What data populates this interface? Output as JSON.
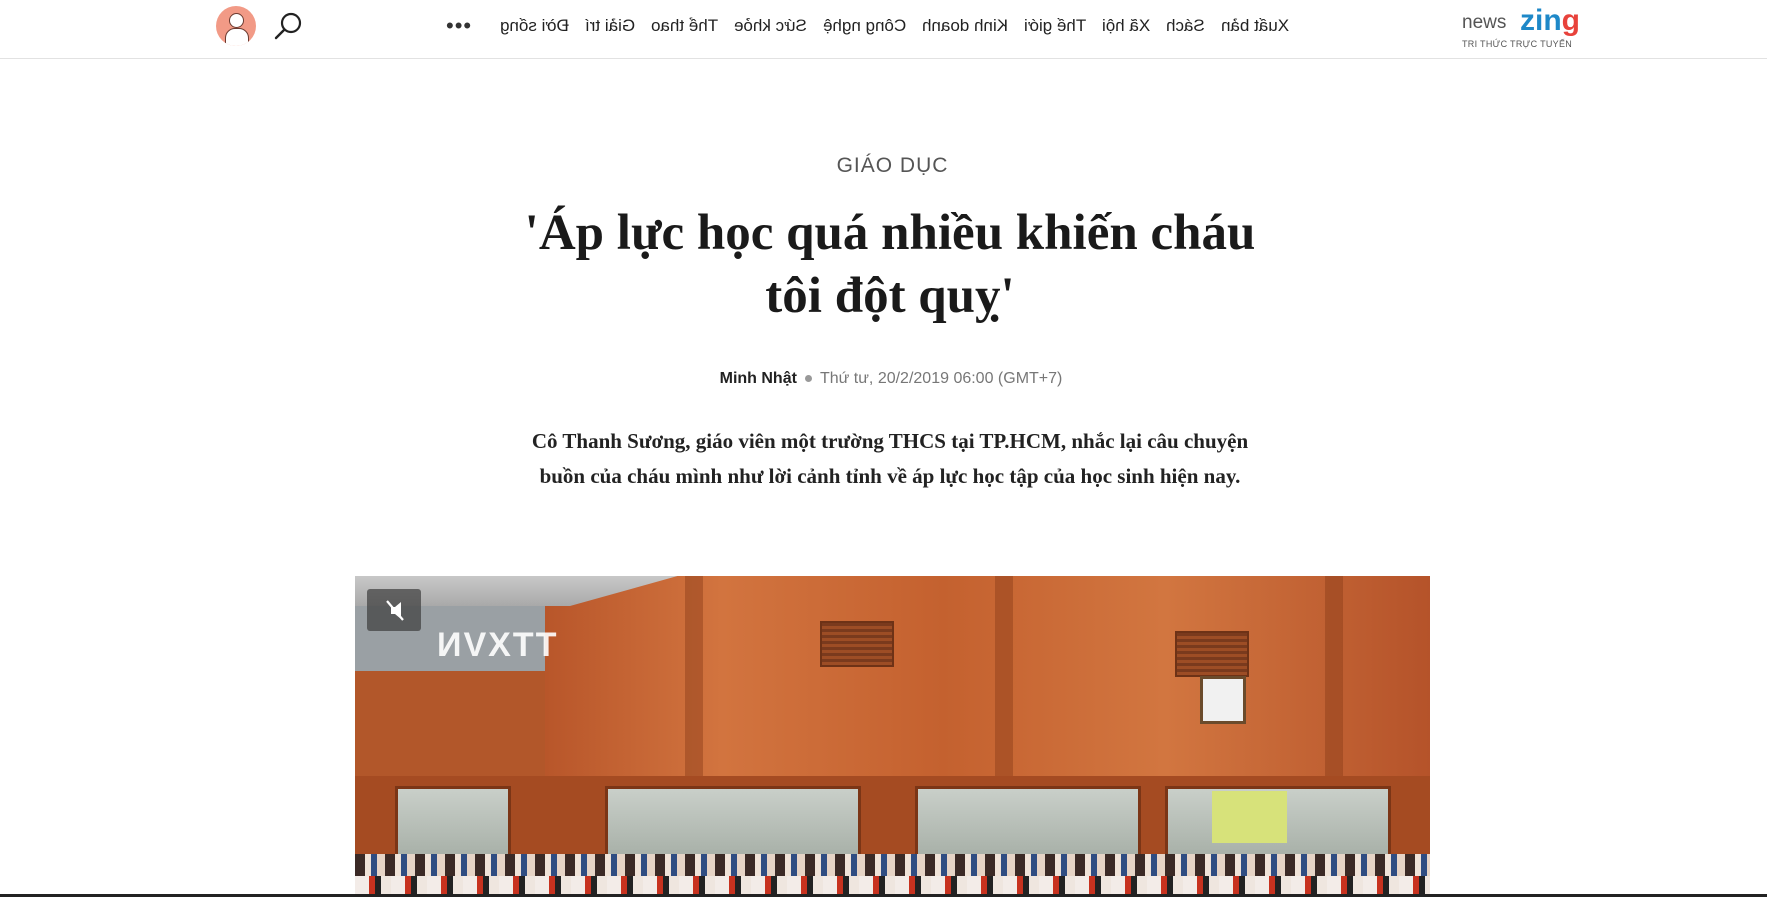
{
  "header": {
    "logo": {
      "brand": "zing",
      "suffix": "news",
      "tagline": "TRI THỨC TRỰC TUYẾN"
    },
    "nav_items": [
      "Xuất bản",
      "Sách",
      "Xã hội",
      "Thế giới",
      "Kinh doanh",
      "Công nghệ",
      "Sức khỏe",
      "Thể thao",
      "Giải trí",
      "Đời sống"
    ],
    "more_label": "•••",
    "icons": {
      "search": "search-icon",
      "avatar": "user-avatar-icon"
    }
  },
  "article": {
    "category": "GIÁO DỤC",
    "title": "'Áp lực học quá nhiều khiến cháu tôi đột quỵ'",
    "author": "Minh Nhật",
    "published": "Thứ tư, 20/2/2019 06:00 (GMT+7)",
    "sapo": "Cô Thanh Sương, giáo viên một trường THCS tại TP.HCM, nhắc lại câu chuyện buồn của cháu mình như lời cảnh tỉnh về áp lực học tập của học sinh hiện nay."
  },
  "media": {
    "watermark": "TTXVN",
    "mute_icon": "volume-muted-icon"
  },
  "colors": {
    "brand_blue": "#1e88c8",
    "brand_red": "#e8423b",
    "text": "#222222"
  }
}
